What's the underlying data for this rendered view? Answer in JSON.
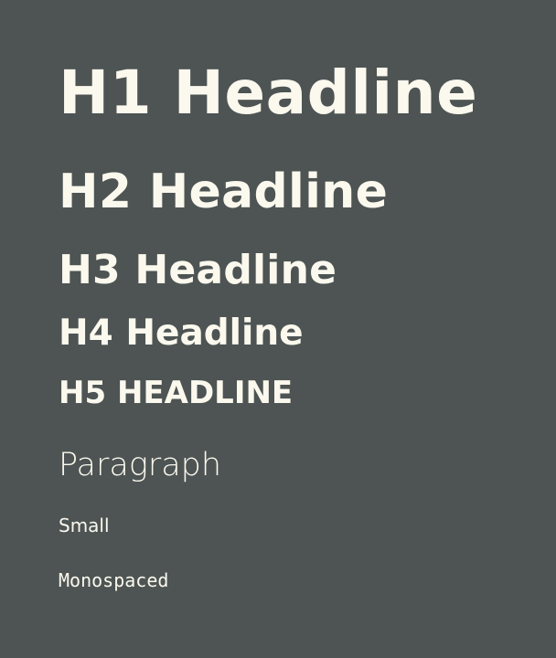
{
  "theme": {
    "background": "#4d5453",
    "text": "#fbf8ee"
  },
  "samples": {
    "h1": "H1 Headline",
    "h2": "H2 Headline",
    "h3": "H3 Headline",
    "h4": "H4 Headline",
    "h5": "H5 HEADLINE",
    "paragraph": "Paragraph",
    "small": "Small",
    "monospaced": "Monospaced"
  }
}
